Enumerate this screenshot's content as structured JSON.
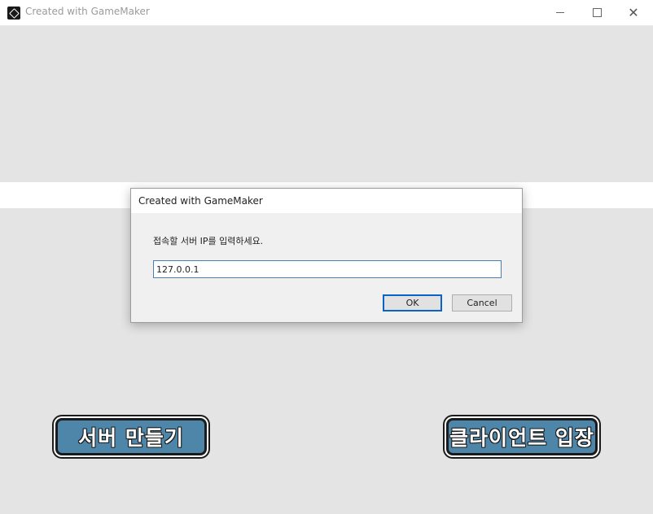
{
  "window": {
    "title": "Created with GameMaker",
    "close_glyph": "✕"
  },
  "dialog": {
    "title": "Created with GameMaker",
    "prompt": "접속할 서버 IP를 입력하세요.",
    "input_value": "127.0.0.1",
    "ok_label": "OK",
    "cancel_label": "Cancel"
  },
  "game": {
    "server_button_label": "서버 만들기",
    "client_button_label": "클라이언트 입장"
  },
  "colors": {
    "background": "#e4e4e4",
    "game_button": "#4d86a8",
    "accent": "#0a63c9"
  },
  "icons": [
    "gamemaker-icon",
    "minimize-icon",
    "maximize-icon",
    "close-icon"
  ]
}
